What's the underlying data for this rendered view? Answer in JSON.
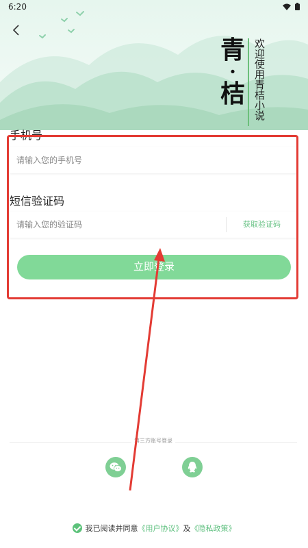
{
  "status_bar": {
    "time": "6:20"
  },
  "brand": {
    "char1": "青",
    "dot": "·",
    "char2": "桔",
    "tagline": "欢迎使用青桔小说"
  },
  "phone": {
    "label": "手机号",
    "placeholder": "请输入您的手机号",
    "value": ""
  },
  "sms": {
    "label": "短信验证码",
    "placeholder": "请输入您的验证码",
    "value": "",
    "get_code_label": "获取验证码"
  },
  "login_button": "立即登录",
  "third_party": {
    "label": "第三方账号登录",
    "options": [
      "wechat-icon",
      "qq-icon"
    ]
  },
  "agreement": {
    "prefix": "我已阅读并同意",
    "user_agreement": "《用户协议》",
    "and": "及",
    "privacy_policy": "《隐私政策》"
  },
  "colors": {
    "accent": "#81d998",
    "link": "#5cbf7d",
    "annotation": "#e33b34"
  }
}
